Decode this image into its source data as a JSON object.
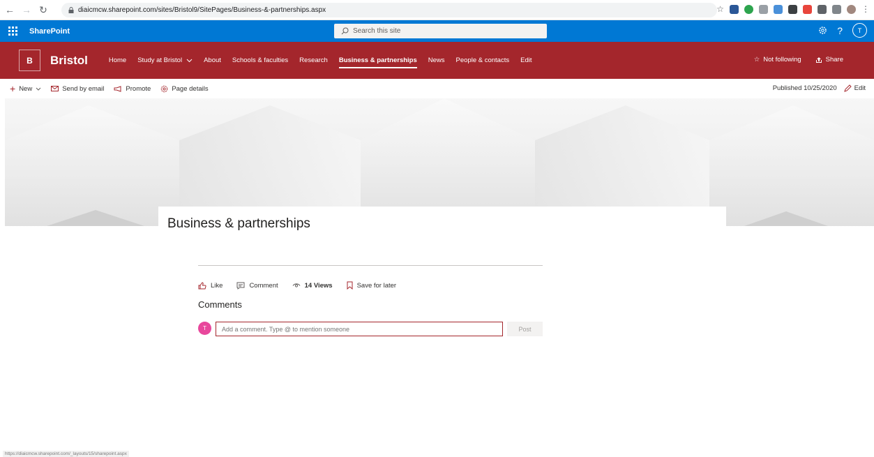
{
  "browser": {
    "url": "diaicmcw.sharepoint.com/sites/Bristol9/SitePages/Business-&-partnerships.aspx",
    "status_url": "https://diaicmcw.sharepoint.com/_layouts/15/sharepoint.aspx"
  },
  "suite": {
    "title": "SharePoint",
    "search_placeholder": "Search this site",
    "help": "?",
    "user_initial": "T"
  },
  "site": {
    "logo_letter": "B",
    "name": "Bristol",
    "nav": [
      {
        "label": "Home"
      },
      {
        "label": "Study at Bristol"
      },
      {
        "label": "About"
      },
      {
        "label": "Schools & faculties"
      },
      {
        "label": "Research"
      },
      {
        "label": "Business & partnerships"
      },
      {
        "label": "News"
      },
      {
        "label": "People & contacts"
      },
      {
        "label": "Edit"
      }
    ],
    "not_following": "Not following",
    "share": "Share"
  },
  "command_bar": {
    "new": "New",
    "send_by_email": "Send by email",
    "promote": "Promote",
    "page_details": "Page details",
    "published": "Published 10/25/2020",
    "edit": "Edit"
  },
  "page": {
    "title": "Business & partnerships"
  },
  "social": {
    "like": "Like",
    "comment": "Comment",
    "views": "14 Views",
    "save_for_later": "Save for later"
  },
  "comments": {
    "heading": "Comments",
    "avatar_initial": "T",
    "placeholder": "Add a comment. Type @ to mention someone",
    "post": "Post"
  },
  "colors": {
    "suite_blue": "#0078d4",
    "brand_red": "#a4262c",
    "avatar_pink": "#e8479c"
  }
}
